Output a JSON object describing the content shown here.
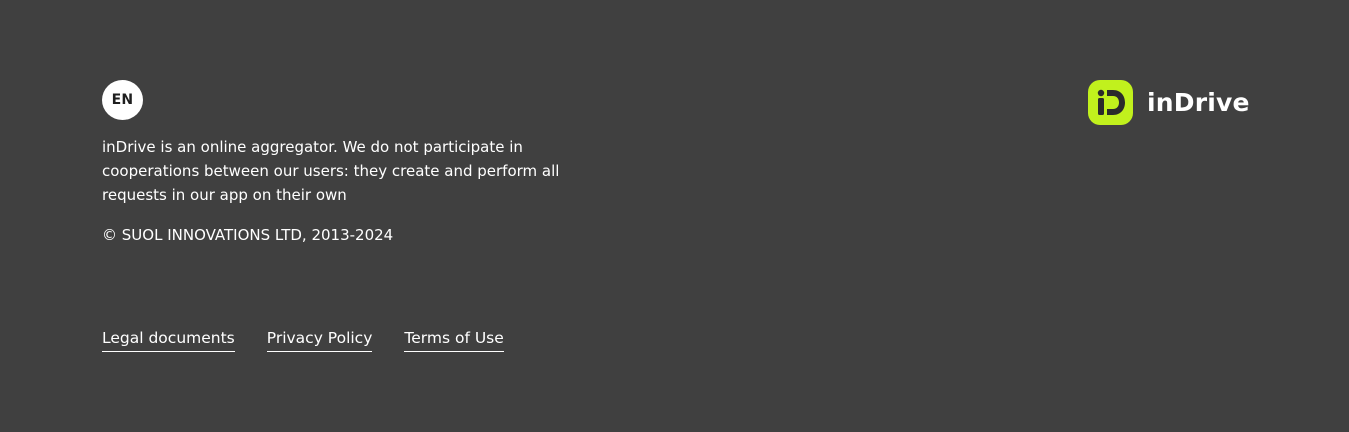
{
  "footer": {
    "language": {
      "label": "EN"
    },
    "description": "inDrive is an online aggregator. We do not participate in cooperations between our users: they create and perform all requests in our app on their own",
    "copyright": "© SUOL INNOVATIONS LTD, 2013-2024",
    "links": [
      {
        "label": "Legal documents"
      },
      {
        "label": "Privacy Policy"
      },
      {
        "label": "Terms of Use"
      }
    ],
    "brand": {
      "name": "inDrive",
      "icon": "indrive-logo-icon",
      "accent_color": "#c1f11d"
    },
    "colors": {
      "background": "#404040",
      "text": "#ffffff"
    }
  }
}
